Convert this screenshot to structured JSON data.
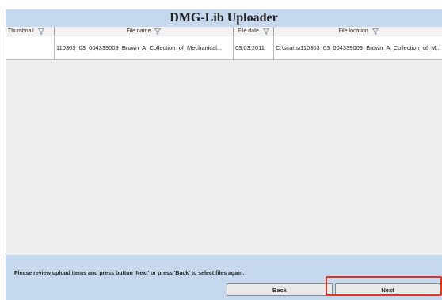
{
  "app": {
    "title": "DMG-Lib Uploader"
  },
  "table": {
    "columns": [
      {
        "label": "Thumbnail",
        "icon": "filter-icon"
      },
      {
        "label": "File name",
        "icon": "filter-icon"
      },
      {
        "label": "File date",
        "icon": "filter-icon"
      },
      {
        "label": "File location",
        "icon": "filter-icon"
      }
    ],
    "rows": [
      {
        "thumbnail": "",
        "file_name": "110303_03_004339009_Brown_A_Collection_of_Mechanical...",
        "file_date": "03.03.2011",
        "file_location": "C:\\scans\\110303_03_004339009_Brown_A_Collection_of_M..."
      }
    ]
  },
  "footer": {
    "message": "Please review upload items and press button 'Next' or press 'Back' to select files again.",
    "back_label": "Back",
    "next_label": "Next"
  },
  "colors": {
    "panel": "#c5d8ee",
    "highlight": "#e0351f"
  }
}
